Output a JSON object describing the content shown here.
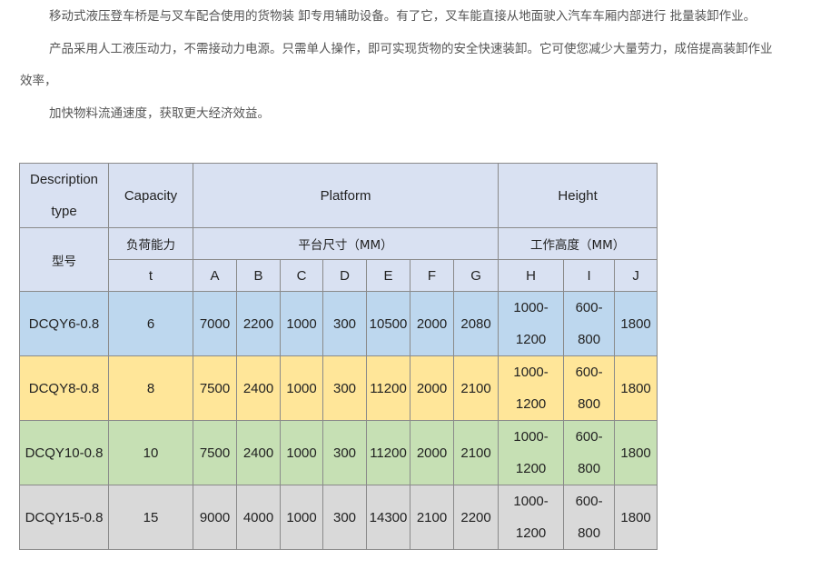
{
  "intro": {
    "p1": "移动式液压登车桥是与叉车配合使用的货物装 卸专用辅助设备。有了它，叉车能直接从地面驶入汽车车厢内部进行 批量装卸作业。",
    "p2_line1": "产品采用人工液压动力，不需接动力电源。只需单人操作，即可实现货物的安全快速装卸。它可使您减少大量劳力，成倍提高装卸作业",
    "p2_line2": "效率，",
    "p3": "加快物料流通速度，获取更大经济效益。"
  },
  "table": {
    "header_en": {
      "description_line1": "Description",
      "description_line2": "type",
      "capacity": "Capacity",
      "platform": "Platform",
      "height": "Height"
    },
    "header_cn": {
      "model": "型号",
      "capacity": "负荷能力",
      "platform": "平台尺寸（MM）",
      "height": "工作高度（MM）"
    },
    "units": {
      "capacity": "t",
      "cols": [
        "A",
        "B",
        "C",
        "D",
        "E",
        "F",
        "G",
        "H",
        "I",
        "J"
      ]
    },
    "rows": [
      {
        "model": "DCQY6-0.8",
        "capacity": "6",
        "A": "7000",
        "B": "2200",
        "C": "1000",
        "D": "300",
        "E": "10500",
        "F": "2000",
        "G": "2080",
        "H1": "1000-",
        "H2": "1200",
        "I1": "600-",
        "I2": "800",
        "J": "1800",
        "color": "#bdd7ee"
      },
      {
        "model": "DCQY8-0.8",
        "capacity": "8",
        "A": "7500",
        "B": "2400",
        "C": "1000",
        "D": "300",
        "E": "11200",
        "F": "2000",
        "G": "2100",
        "H1": "1000-",
        "H2": "1200",
        "I1": "600-",
        "I2": "800",
        "J": "1800",
        "color": "#ffe699"
      },
      {
        "model": "DCQY10-0.8",
        "capacity": "10",
        "A": "7500",
        "B": "2400",
        "C": "1000",
        "D": "300",
        "E": "11200",
        "F": "2000",
        "G": "2100",
        "H1": "1000-",
        "H2": "1200",
        "I1": "600-",
        "I2": "800",
        "J": "1800",
        "color": "#c6e0b4"
      },
      {
        "model": "DCQY15-0.8",
        "capacity": "15",
        "A": "9000",
        "B": "4000",
        "C": "1000",
        "D": "300",
        "E": "14300",
        "F": "2100",
        "G": "2200",
        "H1": "1000-",
        "H2": "1200",
        "I1": "600-",
        "I2": "800",
        "J": "1800",
        "color": "#d9d9d9"
      }
    ],
    "header_color": "#d9e1f2"
  }
}
